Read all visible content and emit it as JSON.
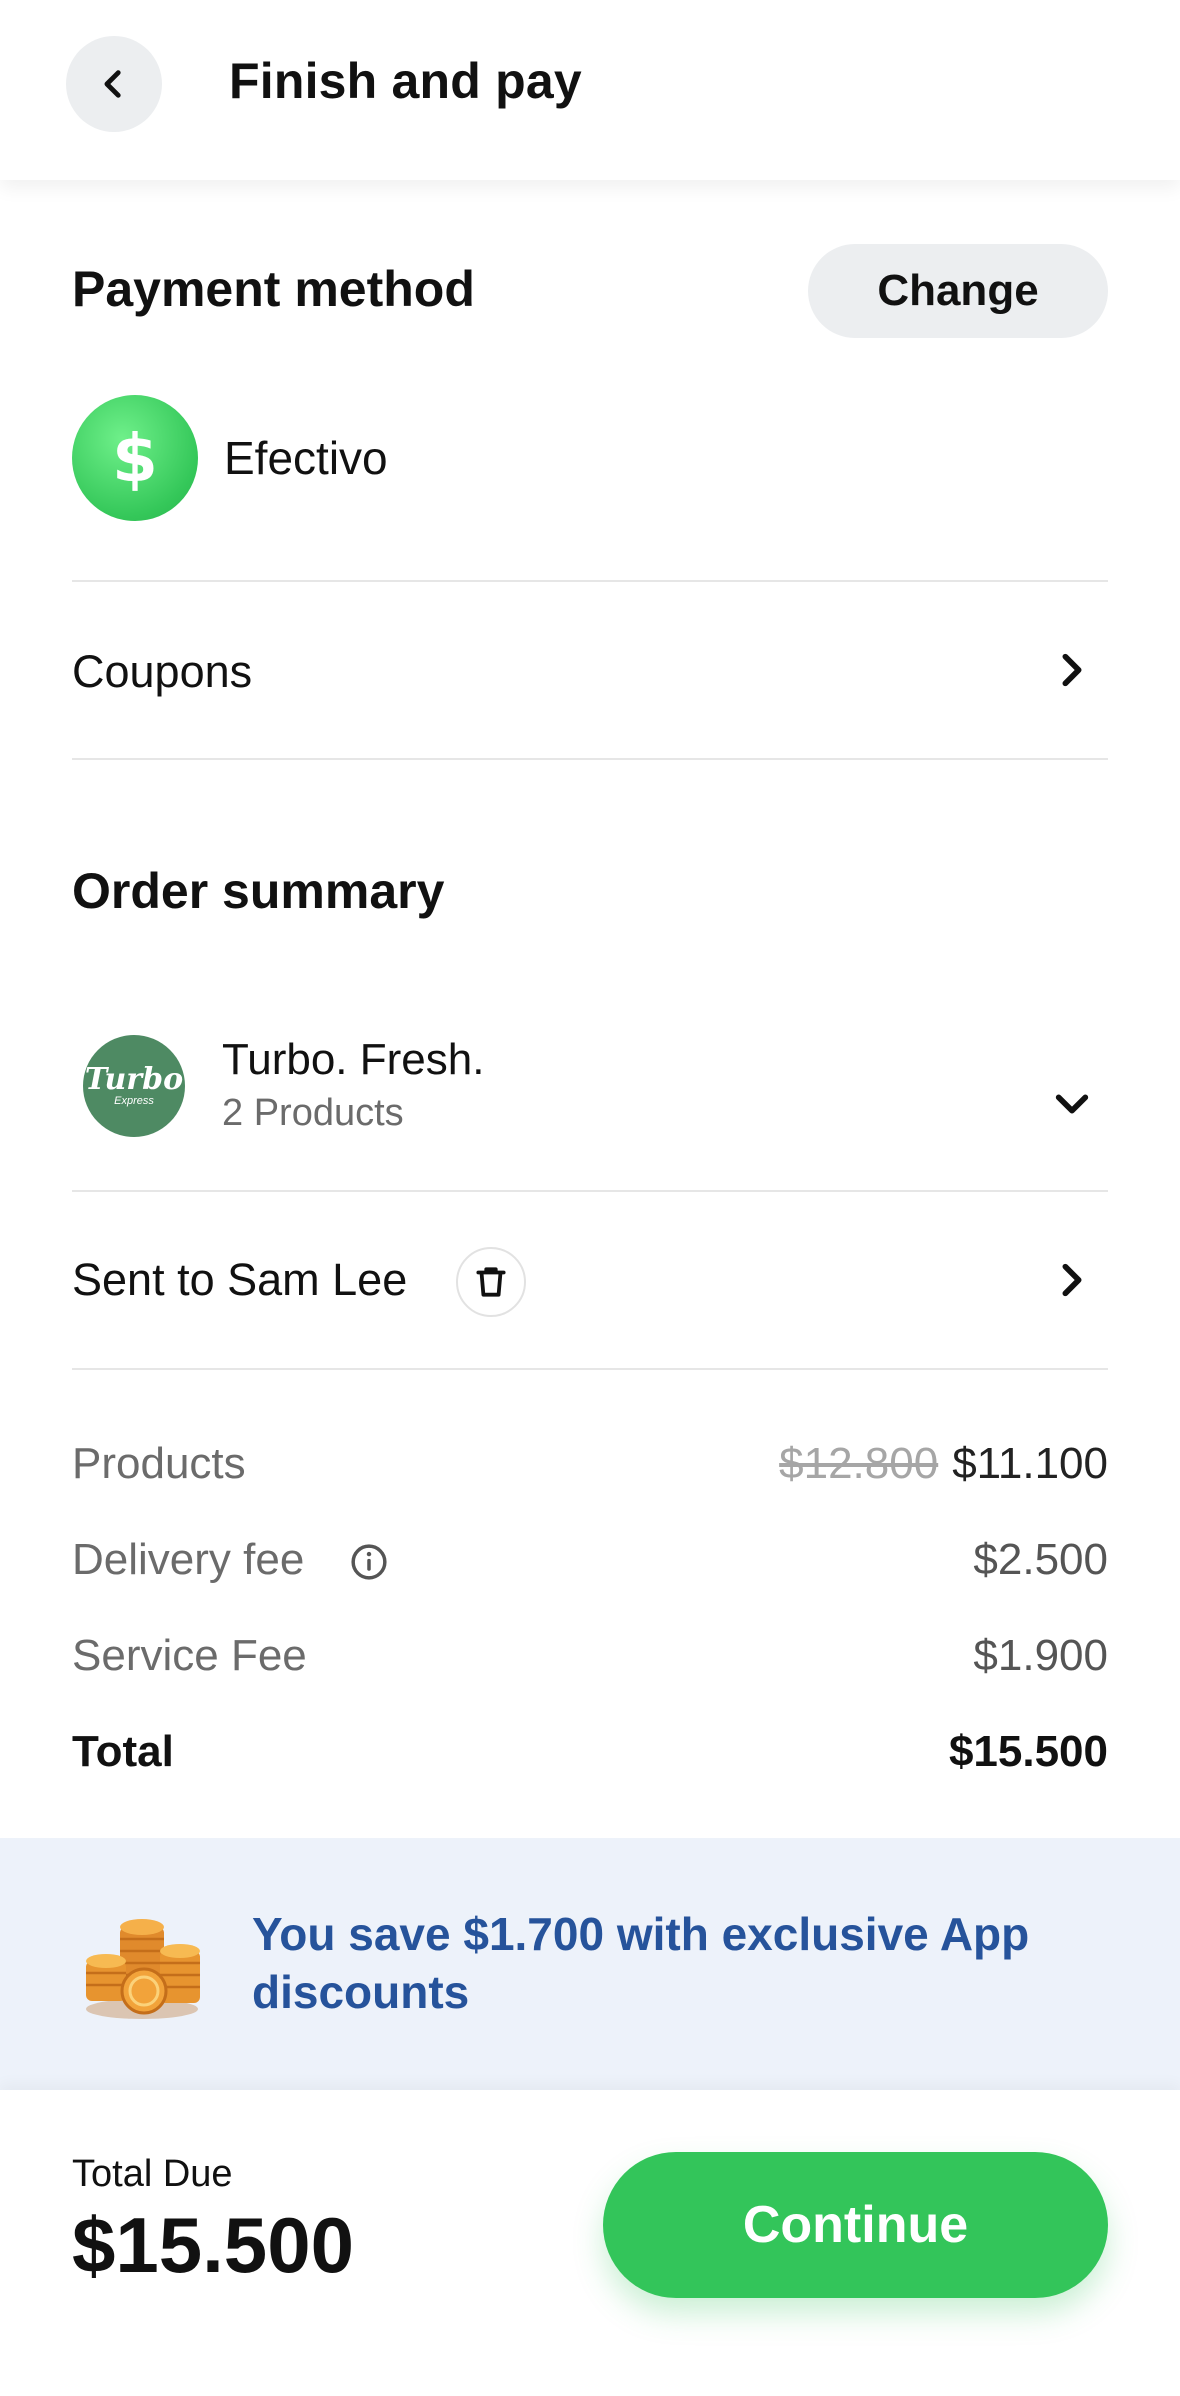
{
  "header": {
    "title": "Finish and pay"
  },
  "payment": {
    "title": "Payment method",
    "change_label": "Change",
    "method_symbol": "$",
    "method_label": "Efectivo"
  },
  "coupons": {
    "label": "Coupons"
  },
  "order": {
    "title": "Order summary",
    "store_logo_line1": "Turbo",
    "store_logo_line2": "Express",
    "store_name": "Turbo. Fresh.",
    "store_products": "2 Products"
  },
  "delivery": {
    "label": "Sent to Sam Lee"
  },
  "summary": {
    "products_label": "Products",
    "products_original": "$12.800",
    "products_value": "$11.100",
    "delivery_label": "Delivery fee",
    "delivery_value": "$2.500",
    "service_label": "Service Fee",
    "service_value": "$1.900",
    "total_label": "Total",
    "total_value": "$15.500"
  },
  "savings": {
    "text": "You save $1.700 with exclusive App discounts"
  },
  "footer": {
    "due_label": "Total Due",
    "due_value": "$15.500",
    "continue_label": "Continue"
  },
  "colors": {
    "accent_green": "#33c55a",
    "savings_blue": "#26539b",
    "savings_bg": "#edf2fa"
  }
}
